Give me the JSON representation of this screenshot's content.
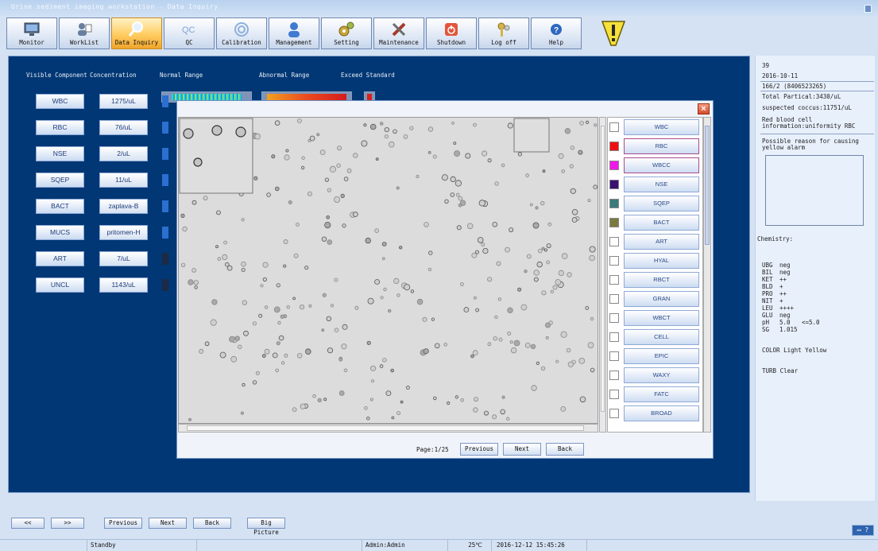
{
  "window": {
    "title": "Urine sediment imaging workstation - Data Inquiry"
  },
  "toolbar": [
    {
      "name": "monitor",
      "label": "Monitor",
      "icon": "monitor-icon"
    },
    {
      "name": "worklist",
      "label": "WorkList",
      "icon": "worklist-icon"
    },
    {
      "name": "data-inquiry",
      "label": "Data Inquiry",
      "icon": "magnifier-icon",
      "active": true
    },
    {
      "name": "qc",
      "label": "QC",
      "icon": "qc-icon"
    },
    {
      "name": "calibration",
      "label": "Calibration",
      "icon": "calibration-icon"
    },
    {
      "name": "management",
      "label": "Management",
      "icon": "user-icon"
    },
    {
      "name": "setting",
      "label": "Setting",
      "icon": "gears-icon"
    },
    {
      "name": "maintenance",
      "label": "Maintenance",
      "icon": "tools-icon"
    },
    {
      "name": "shutdown",
      "label": "Shutdown",
      "icon": "power-icon"
    },
    {
      "name": "logoff",
      "label": "Log off",
      "icon": "keys-icon"
    },
    {
      "name": "help",
      "label": "Help",
      "icon": "help-icon"
    }
  ],
  "headers": {
    "visible_component": "Visible Component",
    "concentration": "Concentration",
    "normal_range": "Normal Range",
    "abnormal_range": "Abnormal Range",
    "exceed_standard": "Exceed Standard"
  },
  "components": [
    {
      "name": "WBC",
      "conc": "1275/uL",
      "dark": false
    },
    {
      "name": "RBC",
      "conc": "76/uL",
      "dark": false
    },
    {
      "name": "NSE",
      "conc": "2/uL",
      "dark": false
    },
    {
      "name": "SQEP",
      "conc": "11/uL",
      "dark": false
    },
    {
      "name": "BACT",
      "conc": "zaplava-B",
      "dark": false
    },
    {
      "name": "MUCS",
      "conc": "pritomen-H",
      "dark": false
    },
    {
      "name": "ART",
      "conc": "7/uL",
      "dark": true
    },
    {
      "name": "UNCL",
      "conc": "1143/uL",
      "dark": true
    }
  ],
  "dialog": {
    "close_label": "×",
    "page_label": "Page:1/25",
    "previous_label": "Previous",
    "next_label": "Next",
    "back_label": "Back",
    "categories": [
      {
        "label": "WBC",
        "color": "#ffffff"
      },
      {
        "label": "RBC",
        "color": "#ee1010"
      },
      {
        "label": "WBCC",
        "color": "#f018e8"
      },
      {
        "label": "NSE",
        "color": "#3a1070"
      },
      {
        "label": "SQEP",
        "color": "#3a7a7a"
      },
      {
        "label": "BACT",
        "color": "#7a7a40"
      },
      {
        "label": "ART",
        "color": "#ffffff"
      },
      {
        "label": "HYAL",
        "color": "#ffffff"
      },
      {
        "label": "RBCT",
        "color": "#ffffff"
      },
      {
        "label": "GRAN",
        "color": "#ffffff"
      },
      {
        "label": "WBCT",
        "color": "#ffffff"
      },
      {
        "label": "CELL",
        "color": "#ffffff"
      },
      {
        "label": "EPIC",
        "color": "#ffffff"
      },
      {
        "label": "WAXY",
        "color": "#ffffff"
      },
      {
        "label": "FATC",
        "color": "#ffffff"
      },
      {
        "label": "BROAD",
        "color": "#ffffff"
      }
    ]
  },
  "info": {
    "sample_no": "39",
    "date": "2016-10-11",
    "barcode": "166/2 (8406523265)",
    "total_particle": "Total Partical:3430/uL",
    "suspected_coccus": "suspected coccus:11751/uL",
    "rbc_info_1": "Red blood cell",
    "rbc_info_2": "information:uniformity RBC",
    "reason_1": "Possible reason for causing",
    "reason_2": "yellow alarm",
    "chemistry_label": "Chemistry:",
    "chemistry": [
      {
        "key": "UBG",
        "value": "neg",
        "ref": ""
      },
      {
        "key": "BIL",
        "value": "neg",
        "ref": ""
      },
      {
        "key": "KET",
        "value": "++",
        "ref": ""
      },
      {
        "key": "BLD",
        "value": "+",
        "ref": ""
      },
      {
        "key": "PRO",
        "value": "++",
        "ref": ""
      },
      {
        "key": "NIT",
        "value": "+",
        "ref": ""
      },
      {
        "key": "LEU",
        "value": "++++",
        "ref": ""
      },
      {
        "key": "GLU",
        "value": "neg",
        "ref": ""
      },
      {
        "key": "pH",
        "value": "5.0",
        "ref": "<=5.0"
      },
      {
        "key": "SG",
        "value": "1.015",
        "ref": ""
      }
    ],
    "color_line": "COLOR Light Yellow",
    "turb_line": "TURB  Clear"
  },
  "bottom": {
    "prev_page": "<<",
    "next_page": ">>",
    "previous": "Previous",
    "next": "Next",
    "back": "Back",
    "big_picture": "Big Picture"
  },
  "status": {
    "state": "Standby",
    "user": "Admin:Admin",
    "temperature": "25℃",
    "datetime": "2016-12-12 15:45:26",
    "help_label": "▭ ?"
  },
  "colors": {
    "panel": "#003774",
    "active_tab": "#ffcc62",
    "accent": "#2b6fd0"
  }
}
